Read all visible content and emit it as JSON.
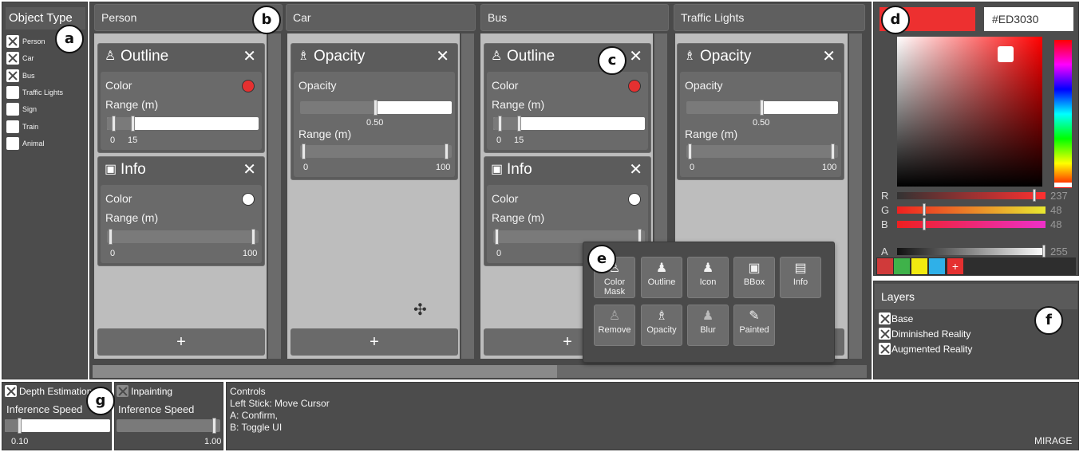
{
  "object_type": {
    "title": "Object Type",
    "items": [
      {
        "label": "Person",
        "checked": true
      },
      {
        "label": "Car",
        "checked": true
      },
      {
        "label": "Bus",
        "checked": true
      },
      {
        "label": "Traffic Lights",
        "checked": false
      },
      {
        "label": "Sign",
        "checked": false
      },
      {
        "label": "Train",
        "checked": false
      },
      {
        "label": "Animal",
        "checked": false
      }
    ]
  },
  "columns": {
    "person": {
      "title": "Person",
      "outline": {
        "title": "Outline",
        "color_label": "Color",
        "color": "#e53030",
        "range_label": "Range (m)",
        "min": "0",
        "max": "15"
      },
      "info": {
        "title": "Info",
        "color_label": "Color",
        "color": "#ffffff",
        "range_label": "Range (m)",
        "min": "0",
        "max": "100"
      }
    },
    "car": {
      "title": "Car",
      "opacity": {
        "title": "Opacity",
        "opacity_label": "Opacity",
        "opacity_value": "0.50",
        "range_label": "Range (m)",
        "min": "0",
        "max": "100"
      }
    },
    "bus": {
      "title": "Bus",
      "outline": {
        "title": "Outline",
        "color_label": "Color",
        "color": "#e53030",
        "range_label": "Range (m)",
        "min": "0",
        "max": "15"
      },
      "info": {
        "title": "Info",
        "color_label": "Color",
        "color": "#ffffff",
        "range_label": "Range (m)",
        "min": "0"
      }
    },
    "traffic": {
      "title": "Traffic Lights",
      "opacity": {
        "title": "Opacity",
        "opacity_label": "Opacity",
        "opacity_value": "0.50",
        "range_label": "Range (m)",
        "min": "0",
        "max": "100"
      }
    },
    "add_symbol": "+",
    "close_symbol": "✕"
  },
  "effects_popup": {
    "items": [
      {
        "label": "Color Mask",
        "icon": "color-mask-icon"
      },
      {
        "label": "Outline",
        "icon": "outline-icon"
      },
      {
        "label": "Icon",
        "icon": "icon-icon"
      },
      {
        "label": "BBox",
        "icon": "bbox-icon"
      },
      {
        "label": "Info",
        "icon": "info-icon"
      },
      {
        "label": "Remove",
        "icon": "remove-icon"
      },
      {
        "label": "Opacity",
        "icon": "opacity-icon"
      },
      {
        "label": "Blur",
        "icon": "blur-icon"
      },
      {
        "label": "Painted",
        "icon": "brush-icon"
      }
    ]
  },
  "color_picker": {
    "hex": "#ED3030",
    "current_color": "#ED3030",
    "r_label": "R",
    "r_value": "237",
    "g_label": "G",
    "g_value": "48",
    "b_label": "B",
    "b_value": "48",
    "a_label": "A",
    "a_value": "255",
    "swatches": [
      "#d03a3a",
      "#3fb24a",
      "#f2ea10",
      "#2fb0e8"
    ],
    "add_swatch": "+"
  },
  "layers": {
    "title": "Layers",
    "items": [
      {
        "label": "Base",
        "checked": true
      },
      {
        "label": "Diminished Reality",
        "checked": true
      },
      {
        "label": "Augmented Reality",
        "checked": true
      }
    ]
  },
  "depth": {
    "title": "Depth Estimation",
    "speed_label": "Inference Speed",
    "value": "0.10"
  },
  "inpainting": {
    "title": "Inpainting",
    "speed_label": "Inference Speed",
    "value": "1.00"
  },
  "controls": {
    "title": "Controls",
    "lines": [
      "Left Stick: Move Cursor",
      "A: Confirm,",
      "B: Toggle UI"
    ],
    "brand": "MIRAGE"
  },
  "badges": [
    "a",
    "b",
    "c",
    "d",
    "e",
    "f",
    "g"
  ]
}
